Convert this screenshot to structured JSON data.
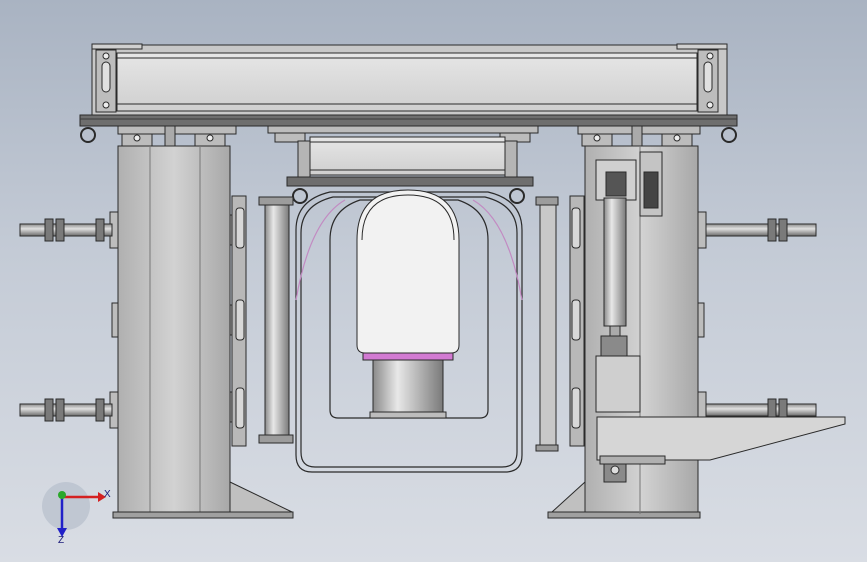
{
  "viewport": {
    "background_top": "#a9b3c2",
    "background_bottom": "#d9dde4",
    "metal_color": "#c9c9c9",
    "metal_dark": "#9a9a9a",
    "edge_color": "#2a2a2a",
    "accent_pink": "#d27ad2"
  },
  "triad": {
    "x_label": "X",
    "z_label": "Z",
    "y_axis_color": "#2aa82a",
    "x_axis_color": "#d42020",
    "z_axis_color": "#2020c8"
  }
}
